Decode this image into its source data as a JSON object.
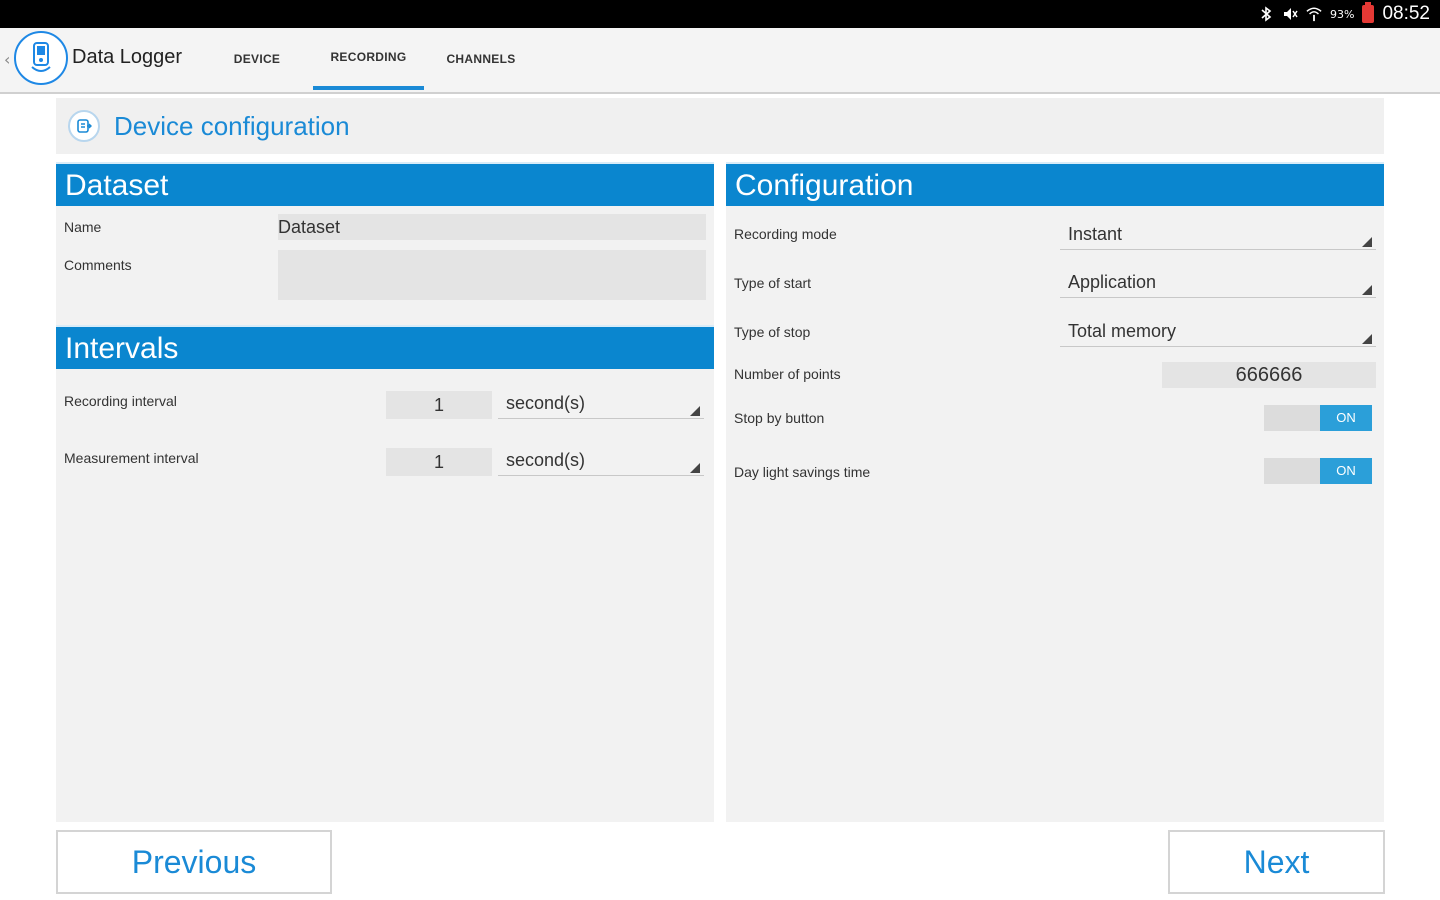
{
  "status_bar": {
    "battery_percent": "93%",
    "time": "08:52",
    "icons": [
      "bluetooth-icon",
      "mute-icon",
      "wifi-icon",
      "battery-icon"
    ]
  },
  "action_bar": {
    "title": "Data Logger",
    "tabs": [
      {
        "label": "DEVICE",
        "active": false
      },
      {
        "label": "RECORDING",
        "active": true
      },
      {
        "label": "CHANNELS",
        "active": false
      }
    ],
    "accent_color": "#1a8ad6"
  },
  "header": {
    "title": "Device configuration"
  },
  "dataset": {
    "heading": "Dataset",
    "name_label": "Name",
    "name_value": "Dataset",
    "comments_label": "Comments",
    "comments_value": ""
  },
  "intervals": {
    "heading": "Intervals",
    "recording_label": "Recording interval",
    "recording_value": "1",
    "recording_unit": "second(s)",
    "measurement_label": "Measurement interval",
    "measurement_value": "1",
    "measurement_unit": "second(s)"
  },
  "configuration": {
    "heading": "Configuration",
    "recording_mode_label": "Recording mode",
    "recording_mode_value": "Instant",
    "type_start_label": "Type of start",
    "type_start_value": "Application",
    "type_stop_label": "Type of stop",
    "type_stop_value": "Total memory",
    "points_label": "Number of points",
    "points_value": "666666",
    "stop_button_label": "Stop by button",
    "stop_button_state": "ON",
    "dst_label": "Day light savings time",
    "dst_state": "ON"
  },
  "footer": {
    "previous_label": "Previous",
    "next_label": "Next"
  }
}
